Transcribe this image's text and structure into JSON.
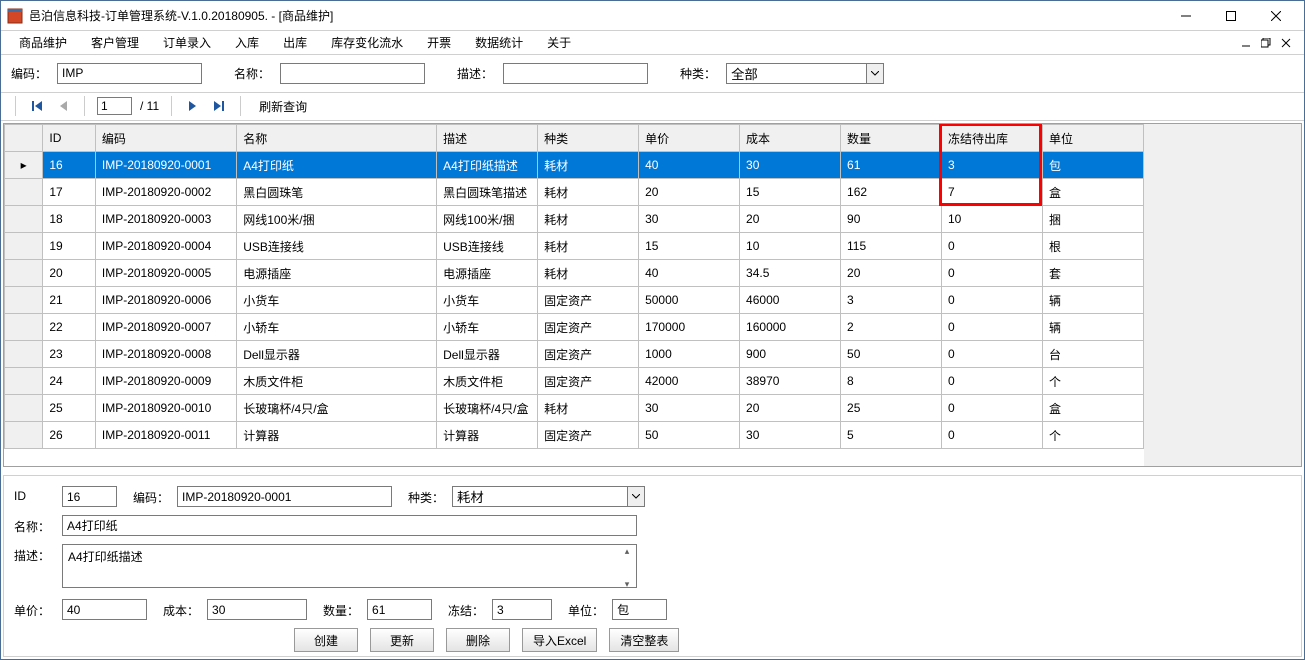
{
  "window": {
    "title": "邑泊信息科技-订单管理系统-V.1.0.20180905. - [商品维护]"
  },
  "menubar": {
    "items": [
      "商品维护",
      "客户管理",
      "订单录入",
      "入库",
      "出库",
      "库存变化流水",
      "开票",
      "数据统计",
      "关于"
    ]
  },
  "filter": {
    "code_label": "编码：",
    "code_value": "IMP",
    "name_label": "名称：",
    "name_value": "",
    "desc_label": "描述：",
    "desc_value": "",
    "cat_label": "种类：",
    "cat_value": "全部"
  },
  "pager": {
    "page": "1",
    "total": "/ 11",
    "refresh": "刷新查询"
  },
  "grid": {
    "headers": {
      "id": "ID",
      "code": "编码",
      "name": "名称",
      "desc": "描述",
      "cat": "种类",
      "price": "单价",
      "cost": "成本",
      "qty": "数量",
      "freeze": "冻结待出库",
      "unit": "单位"
    },
    "rows": [
      {
        "id": "16",
        "code": "IMP-20180920-0001",
        "name": "A4打印纸",
        "desc": "A4打印纸描述",
        "cat": "耗材",
        "price": "40",
        "cost": "30",
        "qty": "61",
        "freeze": "3",
        "unit": "包"
      },
      {
        "id": "17",
        "code": "IMP-20180920-0002",
        "name": "黑白圆珠笔",
        "desc": "黑白圆珠笔描述",
        "cat": "耗材",
        "price": "20",
        "cost": "15",
        "qty": "162",
        "freeze": "7",
        "unit": "盒"
      },
      {
        "id": "18",
        "code": "IMP-20180920-0003",
        "name": "网线100米/捆",
        "desc": "网线100米/捆",
        "cat": "耗材",
        "price": "30",
        "cost": "20",
        "qty": "90",
        "freeze": "10",
        "unit": "捆"
      },
      {
        "id": "19",
        "code": "IMP-20180920-0004",
        "name": "USB连接线",
        "desc": "USB连接线",
        "cat": "耗材",
        "price": "15",
        "cost": "10",
        "qty": "115",
        "freeze": "0",
        "unit": "根"
      },
      {
        "id": "20",
        "code": "IMP-20180920-0005",
        "name": "电源插座",
        "desc": "电源插座",
        "cat": "耗材",
        "price": "40",
        "cost": "34.5",
        "qty": "20",
        "freeze": "0",
        "unit": "套"
      },
      {
        "id": "21",
        "code": "IMP-20180920-0006",
        "name": "小货车",
        "desc": "小货车",
        "cat": "固定资产",
        "price": "50000",
        "cost": "46000",
        "qty": "3",
        "freeze": "0",
        "unit": "辆"
      },
      {
        "id": "22",
        "code": "IMP-20180920-0007",
        "name": "小轿车",
        "desc": "小轿车",
        "cat": "固定资产",
        "price": "170000",
        "cost": "160000",
        "qty": "2",
        "freeze": "0",
        "unit": "辆"
      },
      {
        "id": "23",
        "code": "IMP-20180920-0008",
        "name": "Dell显示器",
        "desc": "Dell显示器",
        "cat": "固定资产",
        "price": "1000",
        "cost": "900",
        "qty": "50",
        "freeze": "0",
        "unit": "台"
      },
      {
        "id": "24",
        "code": "IMP-20180920-0009",
        "name": "木质文件柜",
        "desc": "木质文件柜",
        "cat": "固定资产",
        "price": "42000",
        "cost": "38970",
        "qty": "8",
        "freeze": "0",
        "unit": "个"
      },
      {
        "id": "25",
        "code": "IMP-20180920-0010",
        "name": "长玻璃杯/4只/盒",
        "desc": "长玻璃杯/4只/盒",
        "cat": "耗材",
        "price": "30",
        "cost": "20",
        "qty": "25",
        "freeze": "0",
        "unit": "盒"
      },
      {
        "id": "26",
        "code": "IMP-20180920-0011",
        "name": "计算器",
        "desc": "计算器",
        "cat": "固定资产",
        "price": "50",
        "cost": "30",
        "qty": "5",
        "freeze": "0",
        "unit": "个"
      }
    ],
    "selected_index": 0
  },
  "detail": {
    "id_label": "ID",
    "id_value": "16",
    "code_label": "编码：",
    "code_value": "IMP-20180920-0001",
    "cat_label": "种类：",
    "cat_value": "耗材",
    "name_label": "名称：",
    "name_value": "A4打印纸",
    "desc_label": "描述：",
    "desc_value": "A4打印纸描述",
    "price_label": "单价：",
    "price_value": "40",
    "cost_label": "成本：",
    "cost_value": "30",
    "qty_label": "数量：",
    "qty_value": "61",
    "freeze_label": "冻结：",
    "freeze_value": "3",
    "unit_label": "单位：",
    "unit_value": "包",
    "buttons": {
      "create": "创建",
      "update": "更新",
      "delete": "删除",
      "import": "导入Excel",
      "clear": "清空整表"
    }
  }
}
